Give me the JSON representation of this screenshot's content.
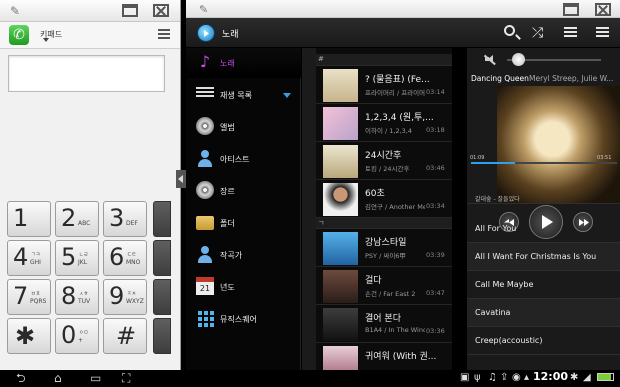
{
  "dialer": {
    "keypad_label": "키패드",
    "keys": [
      {
        "digit": "1",
        "letters": "",
        "top": ""
      },
      {
        "digit": "2",
        "letters": "ABC",
        "top": ""
      },
      {
        "digit": "3",
        "letters": "DEF",
        "top": ""
      },
      {
        "digit": "4",
        "letters": "GHI",
        "top": "ㄱㅋ"
      },
      {
        "digit": "5",
        "letters": "JKL",
        "top": "ㄴㄹ"
      },
      {
        "digit": "6",
        "letters": "MNO",
        "top": "ㄷㅌ"
      },
      {
        "digit": "7",
        "letters": "PQRS",
        "top": "ㅂㅍ"
      },
      {
        "digit": "8",
        "letters": "TUV",
        "top": "ㅅㅎ"
      },
      {
        "digit": "9",
        "letters": "WXYZ",
        "top": "ㅈㅊ"
      },
      {
        "digit": "✱",
        "letters": "",
        "top": ""
      },
      {
        "digit": "0",
        "letters": "+",
        "top": "ㅇㅁ"
      },
      {
        "digit": "#",
        "letters": "",
        "top": ""
      }
    ]
  },
  "music": {
    "title": "노래",
    "categories": [
      {
        "label": "노래",
        "icon": "music-note-icon"
      },
      {
        "label": "재생 목록",
        "icon": "playlist-icon"
      },
      {
        "label": "앨범",
        "icon": "album-icon"
      },
      {
        "label": "아티스트",
        "icon": "artist-icon"
      },
      {
        "label": "장르",
        "icon": "genre-icon"
      },
      {
        "label": "폴더",
        "icon": "folder-icon"
      },
      {
        "label": "작곡가",
        "icon": "composer-icon"
      },
      {
        "label": "년도",
        "icon": "calendar-icon"
      },
      {
        "label": "뮤직스퀘어",
        "icon": "music-square-icon"
      }
    ],
    "sections": [
      "#",
      "ㄱ"
    ],
    "songs": [
      {
        "title": "? (물음표) (Fe...",
        "sub": "프라이머리 / 프라이머리",
        "duration": "03:14"
      },
      {
        "title": "1,2,3,4 (원,투,...",
        "sub": "이하이 / 1,2,3,4",
        "duration": "03:18"
      },
      {
        "title": "24시간후",
        "sub": "토킹 / 24시간후",
        "duration": "03:46"
      },
      {
        "title": "60초",
        "sub": "김연구 / Another Me",
        "duration": "03:34"
      },
      {
        "title": "강남스타일",
        "sub": "PSY / 싸이6甲",
        "duration": "03:39"
      },
      {
        "title": "걸다",
        "sub": "손건 / Far East 2",
        "duration": "03:47"
      },
      {
        "title": "결어 본다",
        "sub": "B1A4 / In The Wind",
        "duration": "03:36"
      },
      {
        "title": "귀여워 (With 권...",
        "sub": "",
        "duration": ""
      }
    ],
    "now_playing": {
      "title": "Dancing Queen",
      "artist": "Meryl Streep, Julie W...",
      "time_elapsed": "01:09",
      "time_total": "03:51",
      "progress_fraction": 0.3
    },
    "queue_partial": "갈대숲 - 잘들었다",
    "queue": [
      "All For You",
      "All I Want For Christmas Is You",
      "Call Me Maybe",
      "Cavatina",
      "Creep(accoustic)"
    ]
  },
  "system": {
    "clock": "12:00",
    "battery_fraction": 0.85
  },
  "colors": {
    "accent_purple": "#c84de6",
    "accent_blue": "#2fa0ec"
  }
}
